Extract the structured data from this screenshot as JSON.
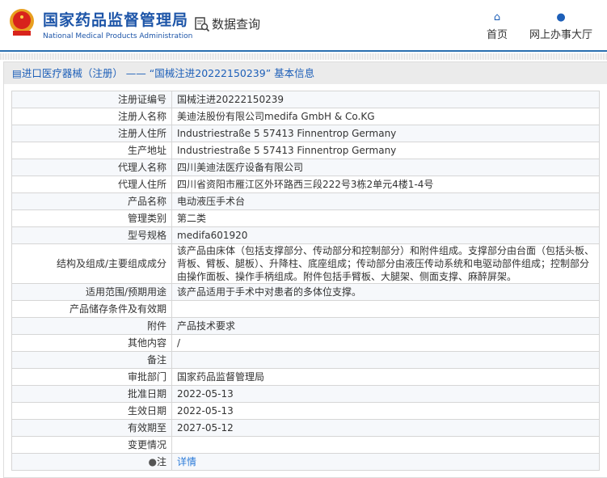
{
  "header": {
    "brand_cn": "国家药品监督管理局",
    "brand_en": "National Medical Products Administration",
    "query": "数据查询",
    "nav": [
      {
        "label": "首页",
        "icon": "home-icon"
      },
      {
        "label": "网上办事大厅",
        "icon": "user-icon"
      }
    ]
  },
  "panel": {
    "title": "进口医疗器械（注册） —— “国械注进20222150239” 基本信息"
  },
  "rows": [
    {
      "label": "注册证编号",
      "value": "国械注进20222150239"
    },
    {
      "label": "注册人名称",
      "value": "美迪法股份有限公司medifa GmbH & Co.KG"
    },
    {
      "label": "注册人住所",
      "value": "Industriestraße 5 57413 Finnentrop Germany"
    },
    {
      "label": "生产地址",
      "value": "Industriestraße 5 57413 Finnentrop Germany"
    },
    {
      "label": "代理人名称",
      "value": "四川美迪法医疗设备有限公司"
    },
    {
      "label": "代理人住所",
      "value": "四川省资阳市雁江区外环路西三段222号3栋2单元4楼1-4号"
    },
    {
      "label": "产品名称",
      "value": "电动液压手术台"
    },
    {
      "label": "管理类别",
      "value": "第二类"
    },
    {
      "label": "型号规格",
      "value": "medifa601920"
    },
    {
      "label": "结构及组成/主要组成成分",
      "value": "该产品由床体（包括支撑部分、传动部分和控制部分）和附件组成。支撑部分由台面（包括头板、背板、臂板、腿板）、升降柱、底座组成；传动部分由液压传动系统和电驱动部件组成；控制部分由操作面板、操作手柄组成。附件包括手臂板、大腿架、侧面支撑、麻醉屏架。"
    },
    {
      "label": "适用范围/预期用途",
      "value": "该产品适用于手术中对患者的多体位支撑。"
    },
    {
      "label": "产品储存条件及有效期",
      "value": ""
    },
    {
      "label": "附件",
      "value": "产品技术要求"
    },
    {
      "label": "其他内容",
      "value": "/"
    },
    {
      "label": "备注",
      "value": ""
    },
    {
      "label": "审批部门",
      "value": "国家药品监督管理局"
    },
    {
      "label": "批准日期",
      "value": "2022-05-13"
    },
    {
      "label": "生效日期",
      "value": "2022-05-13"
    },
    {
      "label": "有效期至",
      "value": "2027-05-12"
    },
    {
      "label": "变更情况",
      "value": ""
    }
  ],
  "note": {
    "label": "注",
    "link": "详情"
  }
}
